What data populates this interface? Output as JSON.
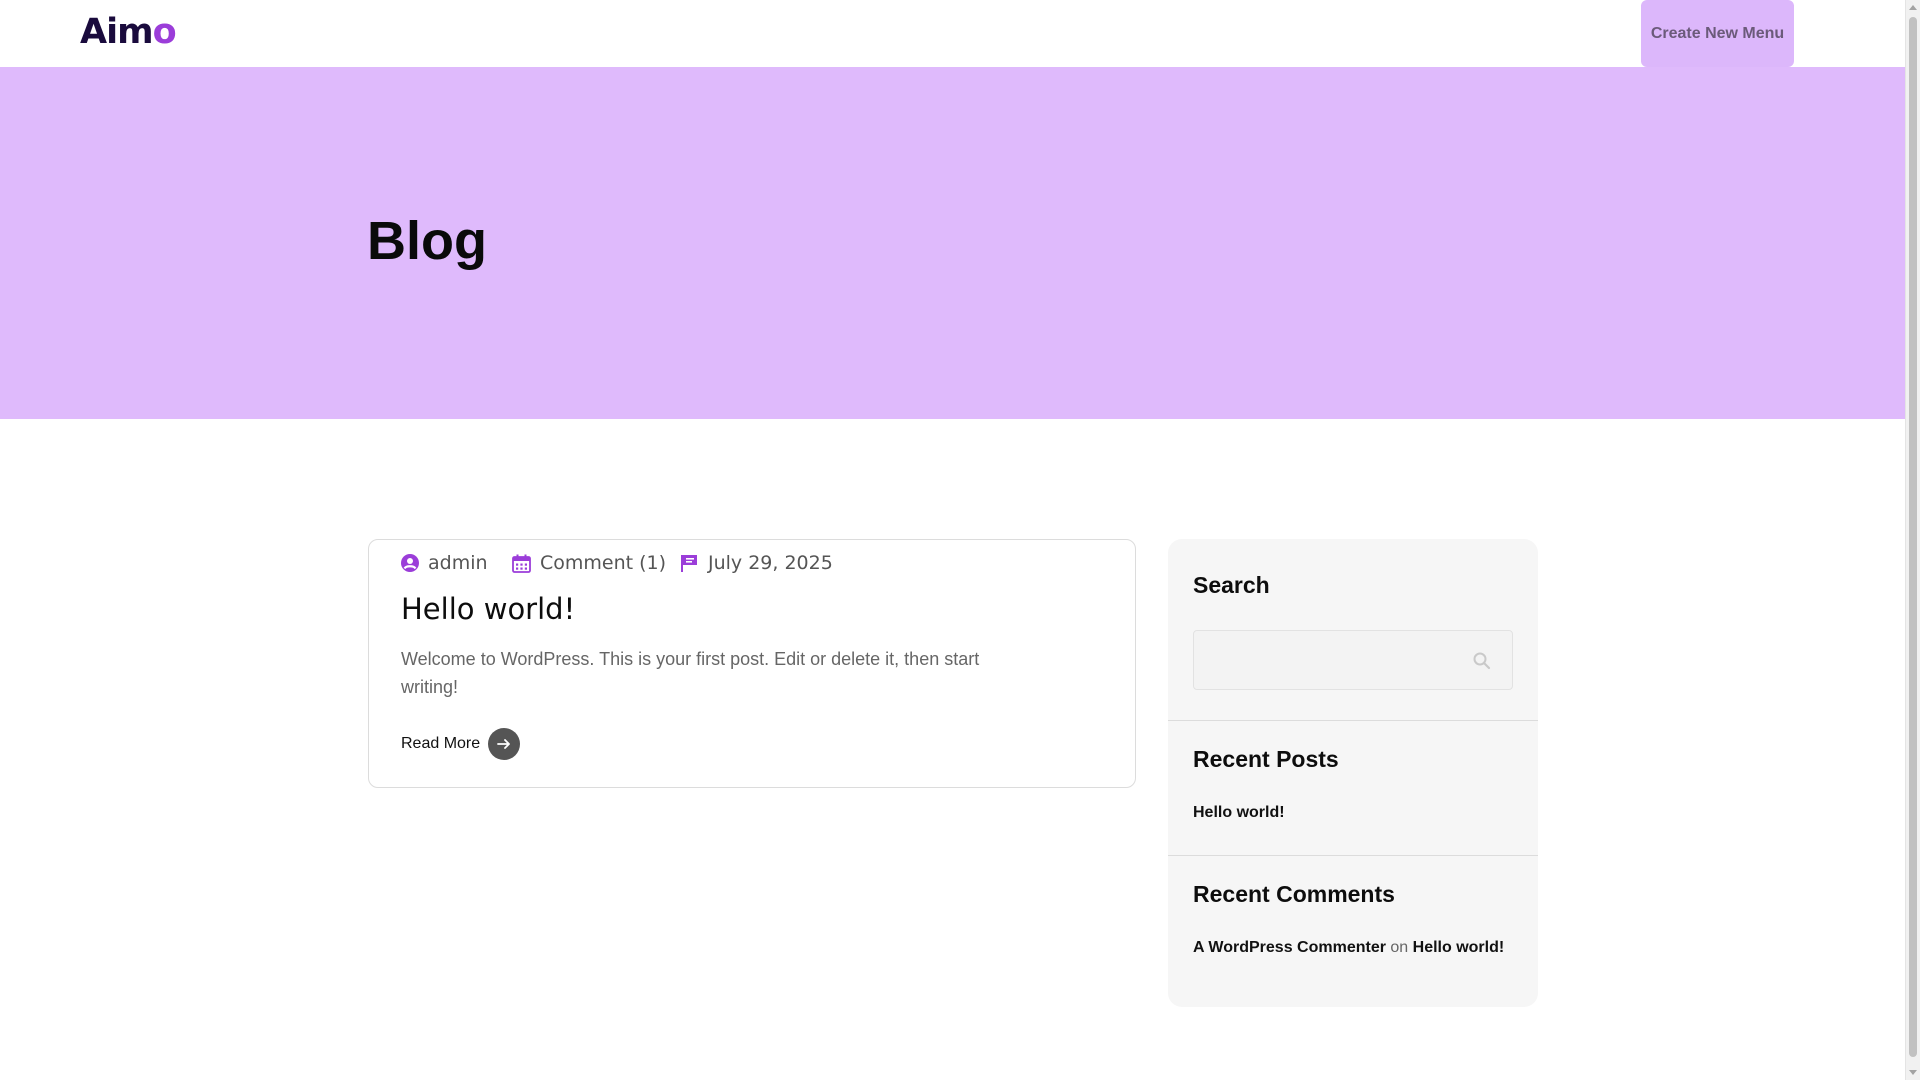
{
  "header": {
    "logo_text_main": "Aim",
    "logo_text_accent": "o",
    "create_menu_label": "Create New Menu"
  },
  "hero": {
    "title": "Blog"
  },
  "post": {
    "author": "admin",
    "comments": "Comment (1)",
    "date": "July 29, 2025",
    "title": "Hello world!",
    "excerpt": "Welcome to WordPress. This is your first post. Edit or delete it, then start writing!",
    "read_more_label": "Read More"
  },
  "sidebar": {
    "search_title": "Search",
    "search_placeholder": "",
    "recent_posts_title": "Recent Posts",
    "recent_posts": [
      "Hello world!"
    ],
    "recent_comments_title": "Recent Comments",
    "recent_comment": {
      "author": "A WordPress Commenter",
      "connector": "on",
      "post": "Hello world!"
    }
  },
  "colors": {
    "accent": "#9b3dd9",
    "hero_bg": "#dfbafc",
    "button_bg": "#dcb7fb"
  },
  "icons": {
    "author": "user-circle-icon",
    "comments": "calendar-icon",
    "date": "flag-icon",
    "read_more": "arrow-right-icon",
    "search": "search-icon"
  }
}
